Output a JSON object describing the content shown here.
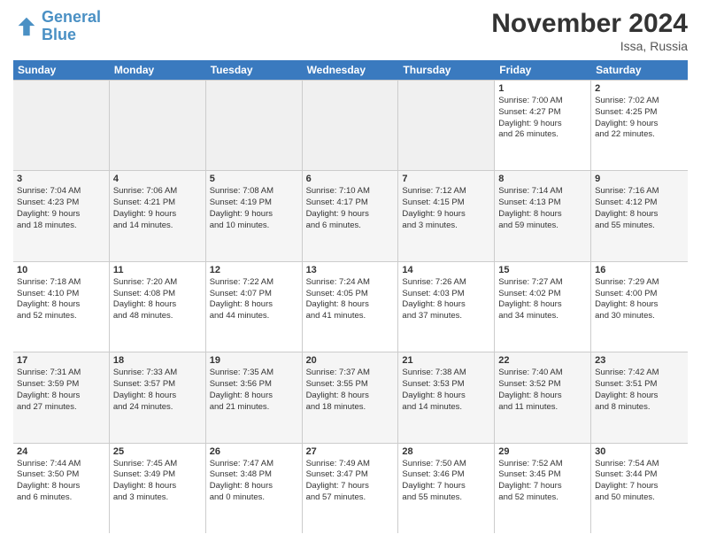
{
  "logo": {
    "line1": "General",
    "line2": "Blue"
  },
  "title": "November 2024",
  "location": "Issa, Russia",
  "header_days": [
    "Sunday",
    "Monday",
    "Tuesday",
    "Wednesday",
    "Thursday",
    "Friday",
    "Saturday"
  ],
  "weeks": [
    [
      {
        "day": "",
        "info": "",
        "empty": true
      },
      {
        "day": "",
        "info": "",
        "empty": true
      },
      {
        "day": "",
        "info": "",
        "empty": true
      },
      {
        "day": "",
        "info": "",
        "empty": true
      },
      {
        "day": "",
        "info": "",
        "empty": true
      },
      {
        "day": "1",
        "info": "Sunrise: 7:00 AM\nSunset: 4:27 PM\nDaylight: 9 hours\nand 26 minutes."
      },
      {
        "day": "2",
        "info": "Sunrise: 7:02 AM\nSunset: 4:25 PM\nDaylight: 9 hours\nand 22 minutes."
      }
    ],
    [
      {
        "day": "3",
        "info": "Sunrise: 7:04 AM\nSunset: 4:23 PM\nDaylight: 9 hours\nand 18 minutes."
      },
      {
        "day": "4",
        "info": "Sunrise: 7:06 AM\nSunset: 4:21 PM\nDaylight: 9 hours\nand 14 minutes."
      },
      {
        "day": "5",
        "info": "Sunrise: 7:08 AM\nSunset: 4:19 PM\nDaylight: 9 hours\nand 10 minutes."
      },
      {
        "day": "6",
        "info": "Sunrise: 7:10 AM\nSunset: 4:17 PM\nDaylight: 9 hours\nand 6 minutes."
      },
      {
        "day": "7",
        "info": "Sunrise: 7:12 AM\nSunset: 4:15 PM\nDaylight: 9 hours\nand 3 minutes."
      },
      {
        "day": "8",
        "info": "Sunrise: 7:14 AM\nSunset: 4:13 PM\nDaylight: 8 hours\nand 59 minutes."
      },
      {
        "day": "9",
        "info": "Sunrise: 7:16 AM\nSunset: 4:12 PM\nDaylight: 8 hours\nand 55 minutes."
      }
    ],
    [
      {
        "day": "10",
        "info": "Sunrise: 7:18 AM\nSunset: 4:10 PM\nDaylight: 8 hours\nand 52 minutes."
      },
      {
        "day": "11",
        "info": "Sunrise: 7:20 AM\nSunset: 4:08 PM\nDaylight: 8 hours\nand 48 minutes."
      },
      {
        "day": "12",
        "info": "Sunrise: 7:22 AM\nSunset: 4:07 PM\nDaylight: 8 hours\nand 44 minutes."
      },
      {
        "day": "13",
        "info": "Sunrise: 7:24 AM\nSunset: 4:05 PM\nDaylight: 8 hours\nand 41 minutes."
      },
      {
        "day": "14",
        "info": "Sunrise: 7:26 AM\nSunset: 4:03 PM\nDaylight: 8 hours\nand 37 minutes."
      },
      {
        "day": "15",
        "info": "Sunrise: 7:27 AM\nSunset: 4:02 PM\nDaylight: 8 hours\nand 34 minutes."
      },
      {
        "day": "16",
        "info": "Sunrise: 7:29 AM\nSunset: 4:00 PM\nDaylight: 8 hours\nand 30 minutes."
      }
    ],
    [
      {
        "day": "17",
        "info": "Sunrise: 7:31 AM\nSunset: 3:59 PM\nDaylight: 8 hours\nand 27 minutes."
      },
      {
        "day": "18",
        "info": "Sunrise: 7:33 AM\nSunset: 3:57 PM\nDaylight: 8 hours\nand 24 minutes."
      },
      {
        "day": "19",
        "info": "Sunrise: 7:35 AM\nSunset: 3:56 PM\nDaylight: 8 hours\nand 21 minutes."
      },
      {
        "day": "20",
        "info": "Sunrise: 7:37 AM\nSunset: 3:55 PM\nDaylight: 8 hours\nand 18 minutes."
      },
      {
        "day": "21",
        "info": "Sunrise: 7:38 AM\nSunset: 3:53 PM\nDaylight: 8 hours\nand 14 minutes."
      },
      {
        "day": "22",
        "info": "Sunrise: 7:40 AM\nSunset: 3:52 PM\nDaylight: 8 hours\nand 11 minutes."
      },
      {
        "day": "23",
        "info": "Sunrise: 7:42 AM\nSunset: 3:51 PM\nDaylight: 8 hours\nand 8 minutes."
      }
    ],
    [
      {
        "day": "24",
        "info": "Sunrise: 7:44 AM\nSunset: 3:50 PM\nDaylight: 8 hours\nand 6 minutes."
      },
      {
        "day": "25",
        "info": "Sunrise: 7:45 AM\nSunset: 3:49 PM\nDaylight: 8 hours\nand 3 minutes."
      },
      {
        "day": "26",
        "info": "Sunrise: 7:47 AM\nSunset: 3:48 PM\nDaylight: 8 hours\nand 0 minutes."
      },
      {
        "day": "27",
        "info": "Sunrise: 7:49 AM\nSunset: 3:47 PM\nDaylight: 7 hours\nand 57 minutes."
      },
      {
        "day": "28",
        "info": "Sunrise: 7:50 AM\nSunset: 3:46 PM\nDaylight: 7 hours\nand 55 minutes."
      },
      {
        "day": "29",
        "info": "Sunrise: 7:52 AM\nSunset: 3:45 PM\nDaylight: 7 hours\nand 52 minutes."
      },
      {
        "day": "30",
        "info": "Sunrise: 7:54 AM\nSunset: 3:44 PM\nDaylight: 7 hours\nand 50 minutes."
      }
    ]
  ]
}
